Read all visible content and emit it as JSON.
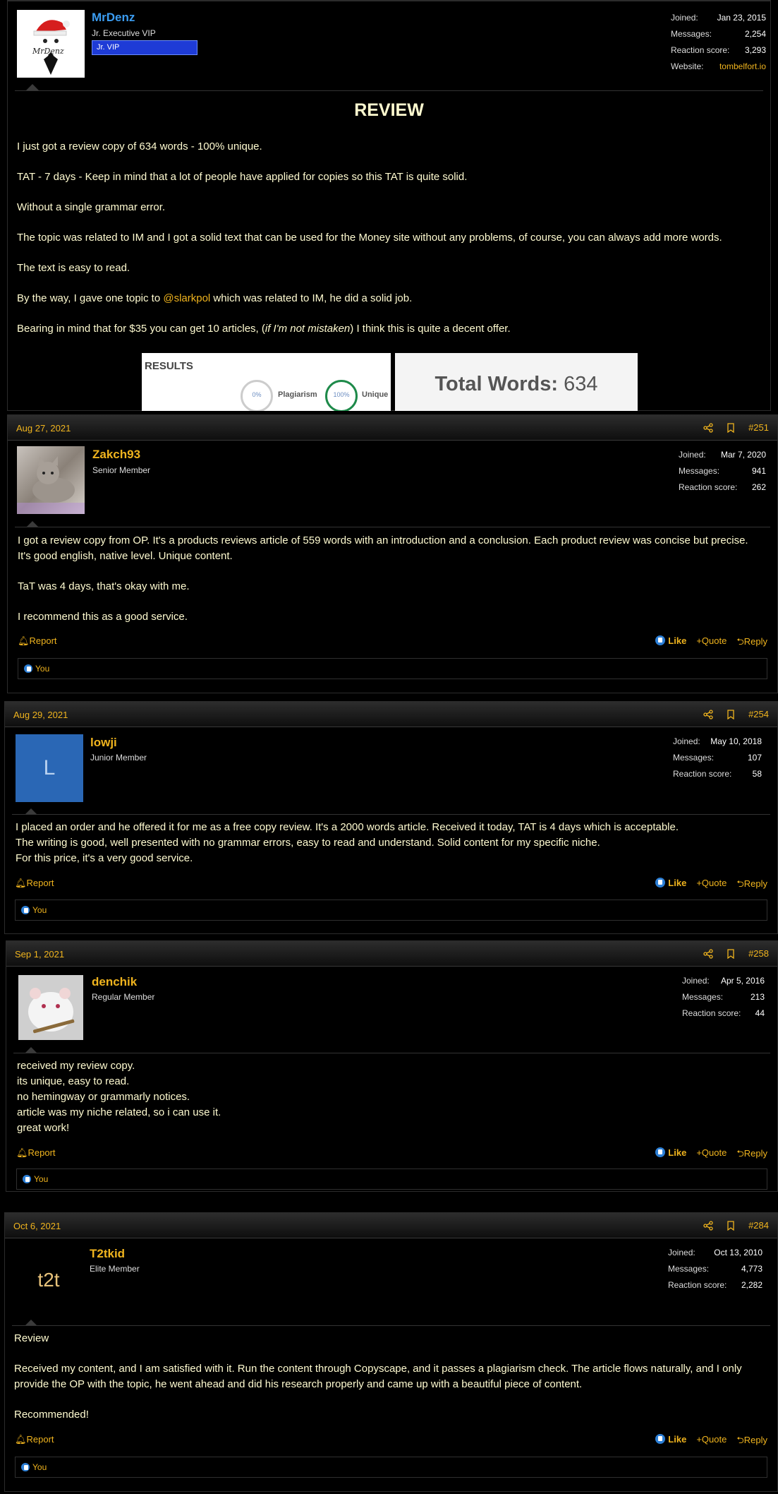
{
  "post1": {
    "username": "MrDenz",
    "title": "Jr. Executive VIP",
    "badge": "Jr. VIP",
    "avatar_text": "MrDenz",
    "stats": [
      {
        "label": "Joined:",
        "value": "Jan 23, 2015"
      },
      {
        "label": "Messages:",
        "value": "2,254"
      },
      {
        "label": "Reaction score:",
        "value": "3,293"
      },
      {
        "label": "Website:",
        "value": "tombelfort.io"
      }
    ],
    "heading": "REVIEW",
    "paragraphs": [
      "I just got a review copy of 634 words - 100% unique.",
      "TAT - 7 days - Keep in mind that a lot of people have applied for copies so this TAT is quite solid.",
      "Without a single grammar error.",
      "The topic was related to IM and I got a solid text that can be used for the Money site without any problems, of course, you can always add more words.",
      "The text is easy to read."
    ],
    "mention_pre": "By the way, I gave one topic to ",
    "mention": "@slarkpol",
    "mention_post": " which was related to IM, he did a solid job.",
    "last_pre": "Bearing in mind that for $35 you can get 10 articles, (",
    "last_italic": "if I'm not mistaken",
    "last_post": ") I think this is quite a decent offer.",
    "results": {
      "title": "RESULTS",
      "plag_value": "0%",
      "plag_label": "Plagiarism",
      "unique_value": "100%",
      "unique_label": "Unique",
      "total_label": "Total Words:",
      "total_value": "634"
    }
  },
  "post2": {
    "date": "Aug 27, 2021",
    "number": "#251",
    "username": "Zakch93",
    "title": "Senior Member",
    "stats": [
      {
        "label": "Joined:",
        "value": "Mar 7, 2020"
      },
      {
        "label": "Messages:",
        "value": "941"
      },
      {
        "label": "Reaction score:",
        "value": "262"
      }
    ],
    "paragraphs": [
      "I got a review copy from OP. It's a products reviews article of 559 words with an introduction and a conclusion. Each product review was concise but precise. It's good english, native level. Unique content.",
      "TaT was 4 days, that's okay with me.",
      "I recommend this as a good service."
    ]
  },
  "post3": {
    "date": "Aug 29, 2021",
    "number": "#254",
    "username": "lowji",
    "title": "Junior Member",
    "avatar_letter": "L",
    "stats": [
      {
        "label": "Joined:",
        "value": "May 10, 2018"
      },
      {
        "label": "Messages:",
        "value": "107"
      },
      {
        "label": "Reaction score:",
        "value": "58"
      }
    ],
    "lines": [
      "I placed an order and he offered it for me as a free copy review. It's a 2000 words article. Received it today, TAT is 4 days which is acceptable.",
      "The writing is good, well presented with no grammar errors, easy to read and understand. Solid content for my specific niche.",
      "For this price, it's a very good service."
    ]
  },
  "post4": {
    "date": "Sep 1, 2021",
    "number": "#258",
    "username": "denchik",
    "title": "Regular Member",
    "stats": [
      {
        "label": "Joined:",
        "value": "Apr 5, 2016"
      },
      {
        "label": "Messages:",
        "value": "213"
      },
      {
        "label": "Reaction score:",
        "value": "44"
      }
    ],
    "lines": [
      "received my review copy.",
      "its unique, easy to read.",
      "no hemingway or grammarly notices.",
      "article was my niche related, so i can use it.",
      "great work!"
    ]
  },
  "post5": {
    "date": "Oct 6, 2021",
    "number": "#284",
    "username": "T2tkid",
    "title": "Elite Member",
    "avatar_text": "t2t",
    "stats": [
      {
        "label": "Joined:",
        "value": "Oct 13, 2010"
      },
      {
        "label": "Messages:",
        "value": "4,773"
      },
      {
        "label": "Reaction score:",
        "value": "2,282"
      }
    ],
    "paragraphs": [
      "Review",
      "Received my content, and I am satisfied with it. Run the content through Copyscape, and it passes a plagiarism check. The article flows naturally, and I only provide the OP with the topic, he went ahead and did his research properly and came up with a beautiful piece of content.",
      "Recommended!"
    ]
  },
  "actions": {
    "report": "Report",
    "like": "Like",
    "quote": "Quote",
    "reply": "Reply",
    "reacted_by": "You"
  },
  "colors": {
    "accent": "#f0b41e",
    "username_blue": "#3b9cf0",
    "badge_blue": "#1e3bd6",
    "like_blue": "#2c7fd6",
    "text": "#fffbd0"
  }
}
